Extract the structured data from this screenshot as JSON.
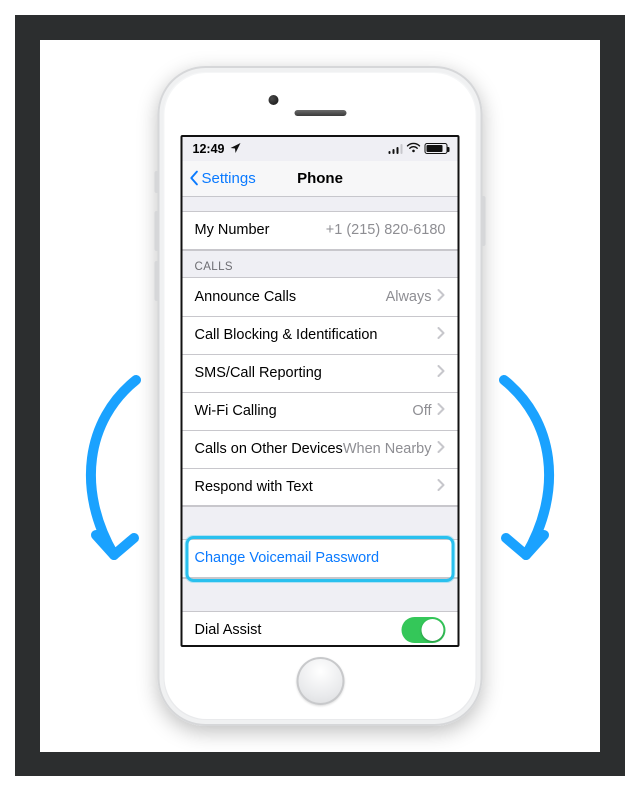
{
  "status": {
    "time": "12:49",
    "battery_pct": 76
  },
  "nav": {
    "back_label": "Settings",
    "title": "Phone"
  },
  "my_number": {
    "label": "My Number",
    "value": "+1 (215) 820-6180"
  },
  "section_calls_header": "CALLS",
  "calls": [
    {
      "label": "Announce Calls",
      "value": "Always",
      "has_value": true
    },
    {
      "label": "Call Blocking & Identification",
      "value": "",
      "has_value": false
    },
    {
      "label": "SMS/Call Reporting",
      "value": "",
      "has_value": false
    },
    {
      "label": "Wi-Fi Calling",
      "value": "Off",
      "has_value": true
    },
    {
      "label": "Calls on Other Devices",
      "value": "When Nearby",
      "has_value": true
    },
    {
      "label": "Respond with Text",
      "value": "",
      "has_value": false
    }
  ],
  "change_voicemail": {
    "label": "Change Voicemail Password"
  },
  "dial_assist": {
    "label": "Dial Assist",
    "on": true
  }
}
